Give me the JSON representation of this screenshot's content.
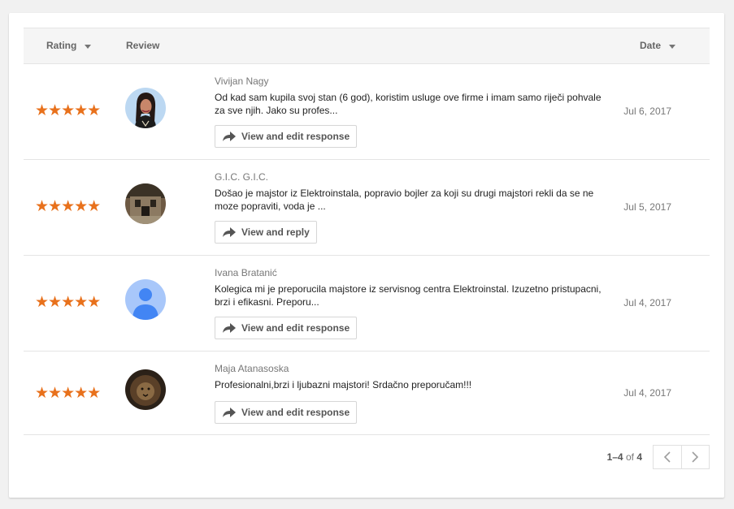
{
  "header": {
    "rating_label": "Rating",
    "review_label": "Review",
    "date_label": "Date"
  },
  "reviews": [
    {
      "stars": "★★★★★",
      "rating": 5,
      "name": "Vivijan Nagy",
      "text": "Od kad sam kupila svoj stan (6 god), koristim usluge ove firme i imam samo riječi pohvale za sve njih. Jako su profes...",
      "action_label": "View and edit response",
      "date": "Jul 6, 2017",
      "avatar": "woman-photo"
    },
    {
      "stars": "★★★★★",
      "rating": 5,
      "name": "G.I.C. G.I.C.",
      "text": "Došao je majstor iz Elektroinstala, popravio bojler za koji su drugi majstori rekli da se ne moze popraviti, voda je ...",
      "action_label": "View and reply",
      "date": "Jul 5, 2017",
      "avatar": "building-photo"
    },
    {
      "stars": "★★★★★",
      "rating": 5,
      "name": "Ivana Bratanić",
      "text": "Kolegica mi je preporucila majstore iz servisnog centra Elektroinstal. Izuzetno pristupacni, brzi i efikasni. Preporu...",
      "action_label": "View and edit response",
      "date": "Jul 4, 2017",
      "avatar": "default-person"
    },
    {
      "stars": "★★★★★",
      "rating": 5,
      "name": "Maja Atanasoska",
      "text": "Profesionalni,brzi i ljubazni majstori! Srdačno preporučam!!!",
      "action_label": "View and edit response",
      "date": "Jul 4, 2017",
      "avatar": "lion-photo"
    }
  ],
  "pagination": {
    "range": "1–4",
    "of_label": "of",
    "total": "4",
    "prev_icon": "chevron-left-icon",
    "next_icon": "chevron-right-icon"
  },
  "colors": {
    "star": "#e8711c",
    "header_bg": "#f5f5f5",
    "avatar_default_bg": "#a8c7fa",
    "avatar_default_fg": "#4285f4"
  }
}
